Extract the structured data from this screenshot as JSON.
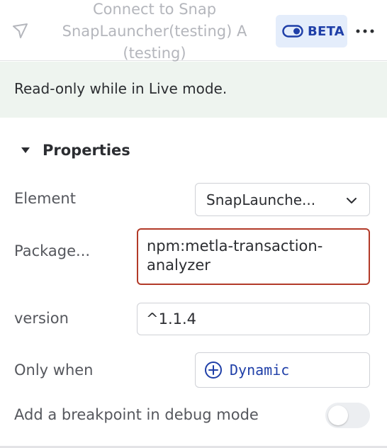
{
  "header": {
    "title": "Connect to Snap SnapLauncher(testing) A (testing)",
    "beta_label": "BETA",
    "icons": {
      "cursor": "cursor-arrow-icon",
      "toggle": "toggle-icon",
      "more": "more-icon"
    }
  },
  "banner": {
    "text": "Read-only while in Live mode."
  },
  "properties": {
    "section_title": "Properties",
    "element": {
      "label": "Element",
      "value": "SnapLaunche..."
    },
    "package": {
      "label": "Package...",
      "value": "npm:metla-transaction-analyzer"
    },
    "version": {
      "label": "version",
      "value": "^1.1.4"
    },
    "only_when": {
      "label": "Only when",
      "button_label": "Dynamic"
    },
    "breakpoint": {
      "label": "Add a breakpoint in debug mode",
      "enabled": false
    }
  },
  "colors": {
    "accent": "#1f3fa8",
    "beta_bg": "#e4edfb",
    "banner_bg": "#eef4ef",
    "error_border": "#b23a28"
  }
}
